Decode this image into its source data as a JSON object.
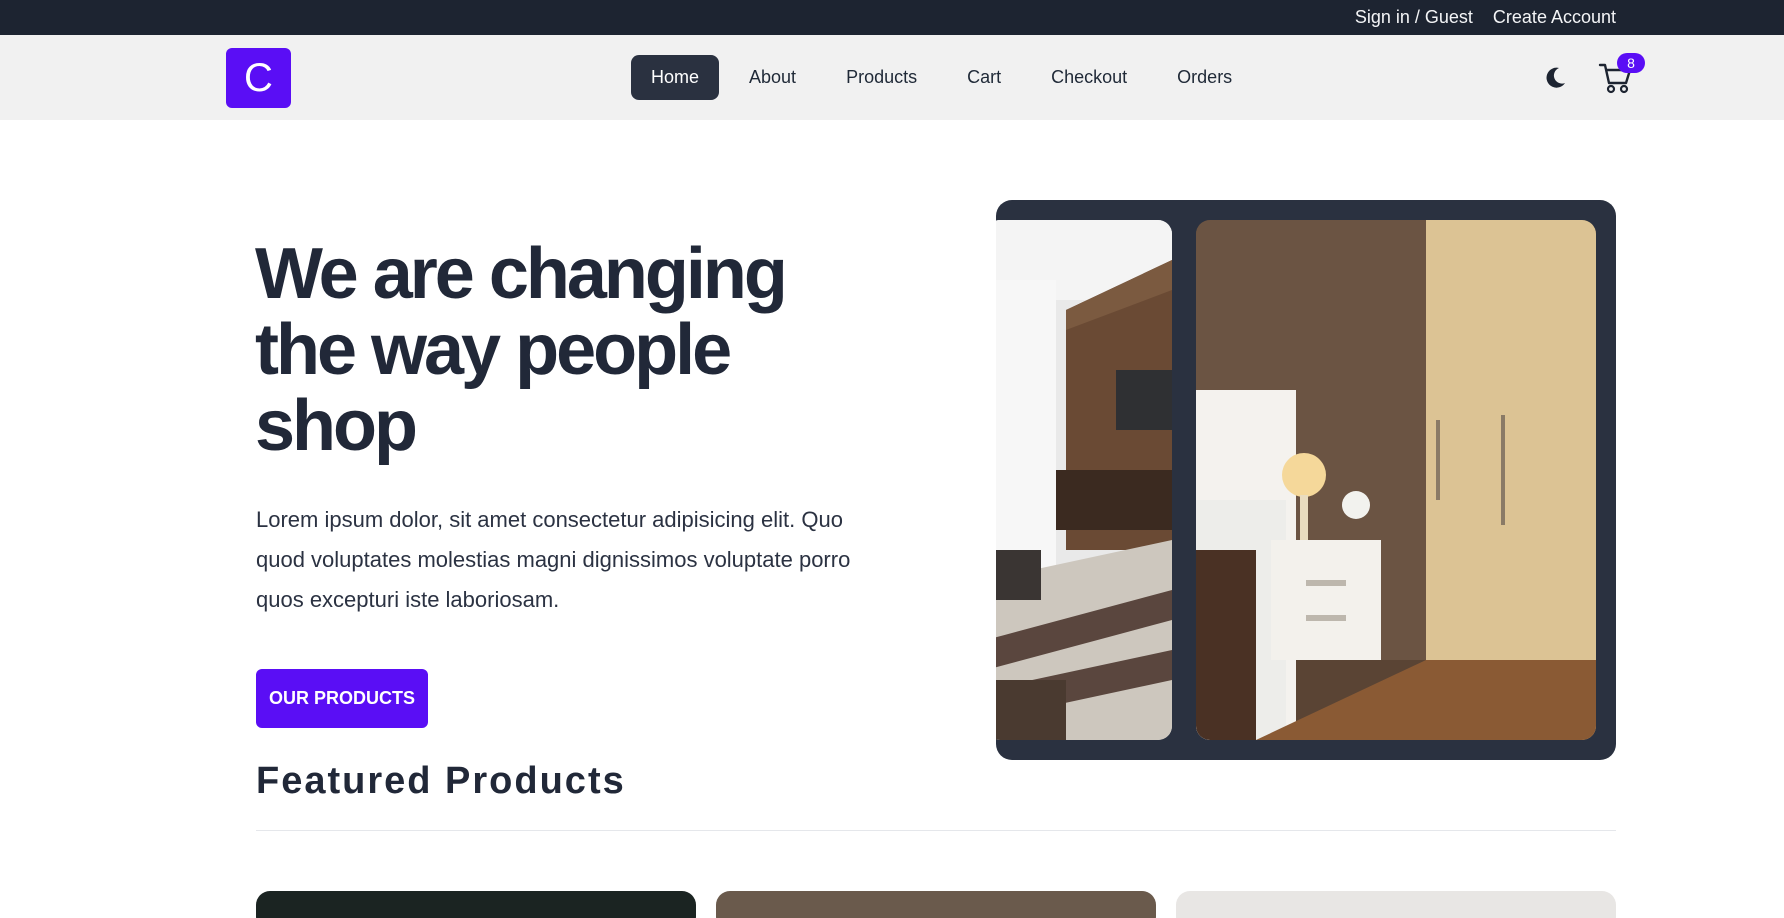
{
  "topbar": {
    "signin": "Sign in / Guest",
    "create_account": "Create Account"
  },
  "nav": {
    "logo_letter": "C",
    "items": [
      {
        "label": "Home",
        "active": true
      },
      {
        "label": "About"
      },
      {
        "label": "Products"
      },
      {
        "label": "Cart"
      },
      {
        "label": "Checkout"
      },
      {
        "label": "Orders"
      }
    ],
    "theme_icon": "moon-icon",
    "cart_icon": "cart-icon",
    "cart_count": "8"
  },
  "hero": {
    "title": "We are changing the way people shop",
    "text": "Lorem ipsum dolor, sit amet consectetur adipisicing elit. Quo quod voluptates molestias magni dignissimos voluptate porro quos excepturi iste laboriosam.",
    "button": "OUR PRODUCTS"
  },
  "featured": {
    "title": "Featured Products"
  },
  "colors": {
    "accent": "#5a0ef5",
    "dark": "#1d2431",
    "nav_bg": "#f1f1f1"
  }
}
